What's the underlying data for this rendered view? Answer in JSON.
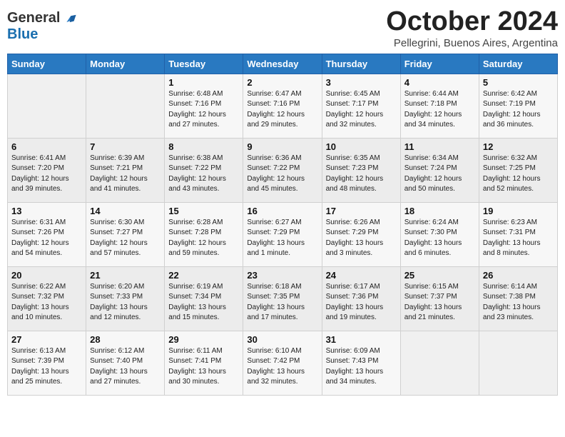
{
  "header": {
    "logo_general": "General",
    "logo_blue": "Blue",
    "month_title": "October 2024",
    "subtitle": "Pellegrini, Buenos Aires, Argentina"
  },
  "days_of_week": [
    "Sunday",
    "Monday",
    "Tuesday",
    "Wednesday",
    "Thursday",
    "Friday",
    "Saturday"
  ],
  "weeks": [
    [
      {
        "num": "",
        "sunrise": "",
        "sunset": "",
        "daylight": ""
      },
      {
        "num": "",
        "sunrise": "",
        "sunset": "",
        "daylight": ""
      },
      {
        "num": "1",
        "sunrise": "Sunrise: 6:48 AM",
        "sunset": "Sunset: 7:16 PM",
        "daylight": "Daylight: 12 hours and 27 minutes."
      },
      {
        "num": "2",
        "sunrise": "Sunrise: 6:47 AM",
        "sunset": "Sunset: 7:16 PM",
        "daylight": "Daylight: 12 hours and 29 minutes."
      },
      {
        "num": "3",
        "sunrise": "Sunrise: 6:45 AM",
        "sunset": "Sunset: 7:17 PM",
        "daylight": "Daylight: 12 hours and 32 minutes."
      },
      {
        "num": "4",
        "sunrise": "Sunrise: 6:44 AM",
        "sunset": "Sunset: 7:18 PM",
        "daylight": "Daylight: 12 hours and 34 minutes."
      },
      {
        "num": "5",
        "sunrise": "Sunrise: 6:42 AM",
        "sunset": "Sunset: 7:19 PM",
        "daylight": "Daylight: 12 hours and 36 minutes."
      }
    ],
    [
      {
        "num": "6",
        "sunrise": "Sunrise: 6:41 AM",
        "sunset": "Sunset: 7:20 PM",
        "daylight": "Daylight: 12 hours and 39 minutes."
      },
      {
        "num": "7",
        "sunrise": "Sunrise: 6:39 AM",
        "sunset": "Sunset: 7:21 PM",
        "daylight": "Daylight: 12 hours and 41 minutes."
      },
      {
        "num": "8",
        "sunrise": "Sunrise: 6:38 AM",
        "sunset": "Sunset: 7:22 PM",
        "daylight": "Daylight: 12 hours and 43 minutes."
      },
      {
        "num": "9",
        "sunrise": "Sunrise: 6:36 AM",
        "sunset": "Sunset: 7:22 PM",
        "daylight": "Daylight: 12 hours and 45 minutes."
      },
      {
        "num": "10",
        "sunrise": "Sunrise: 6:35 AM",
        "sunset": "Sunset: 7:23 PM",
        "daylight": "Daylight: 12 hours and 48 minutes."
      },
      {
        "num": "11",
        "sunrise": "Sunrise: 6:34 AM",
        "sunset": "Sunset: 7:24 PM",
        "daylight": "Daylight: 12 hours and 50 minutes."
      },
      {
        "num": "12",
        "sunrise": "Sunrise: 6:32 AM",
        "sunset": "Sunset: 7:25 PM",
        "daylight": "Daylight: 12 hours and 52 minutes."
      }
    ],
    [
      {
        "num": "13",
        "sunrise": "Sunrise: 6:31 AM",
        "sunset": "Sunset: 7:26 PM",
        "daylight": "Daylight: 12 hours and 54 minutes."
      },
      {
        "num": "14",
        "sunrise": "Sunrise: 6:30 AM",
        "sunset": "Sunset: 7:27 PM",
        "daylight": "Daylight: 12 hours and 57 minutes."
      },
      {
        "num": "15",
        "sunrise": "Sunrise: 6:28 AM",
        "sunset": "Sunset: 7:28 PM",
        "daylight": "Daylight: 12 hours and 59 minutes."
      },
      {
        "num": "16",
        "sunrise": "Sunrise: 6:27 AM",
        "sunset": "Sunset: 7:29 PM",
        "daylight": "Daylight: 13 hours and 1 minute."
      },
      {
        "num": "17",
        "sunrise": "Sunrise: 6:26 AM",
        "sunset": "Sunset: 7:29 PM",
        "daylight": "Daylight: 13 hours and 3 minutes."
      },
      {
        "num": "18",
        "sunrise": "Sunrise: 6:24 AM",
        "sunset": "Sunset: 7:30 PM",
        "daylight": "Daylight: 13 hours and 6 minutes."
      },
      {
        "num": "19",
        "sunrise": "Sunrise: 6:23 AM",
        "sunset": "Sunset: 7:31 PM",
        "daylight": "Daylight: 13 hours and 8 minutes."
      }
    ],
    [
      {
        "num": "20",
        "sunrise": "Sunrise: 6:22 AM",
        "sunset": "Sunset: 7:32 PM",
        "daylight": "Daylight: 13 hours and 10 minutes."
      },
      {
        "num": "21",
        "sunrise": "Sunrise: 6:20 AM",
        "sunset": "Sunset: 7:33 PM",
        "daylight": "Daylight: 13 hours and 12 minutes."
      },
      {
        "num": "22",
        "sunrise": "Sunrise: 6:19 AM",
        "sunset": "Sunset: 7:34 PM",
        "daylight": "Daylight: 13 hours and 15 minutes."
      },
      {
        "num": "23",
        "sunrise": "Sunrise: 6:18 AM",
        "sunset": "Sunset: 7:35 PM",
        "daylight": "Daylight: 13 hours and 17 minutes."
      },
      {
        "num": "24",
        "sunrise": "Sunrise: 6:17 AM",
        "sunset": "Sunset: 7:36 PM",
        "daylight": "Daylight: 13 hours and 19 minutes."
      },
      {
        "num": "25",
        "sunrise": "Sunrise: 6:15 AM",
        "sunset": "Sunset: 7:37 PM",
        "daylight": "Daylight: 13 hours and 21 minutes."
      },
      {
        "num": "26",
        "sunrise": "Sunrise: 6:14 AM",
        "sunset": "Sunset: 7:38 PM",
        "daylight": "Daylight: 13 hours and 23 minutes."
      }
    ],
    [
      {
        "num": "27",
        "sunrise": "Sunrise: 6:13 AM",
        "sunset": "Sunset: 7:39 PM",
        "daylight": "Daylight: 13 hours and 25 minutes."
      },
      {
        "num": "28",
        "sunrise": "Sunrise: 6:12 AM",
        "sunset": "Sunset: 7:40 PM",
        "daylight": "Daylight: 13 hours and 27 minutes."
      },
      {
        "num": "29",
        "sunrise": "Sunrise: 6:11 AM",
        "sunset": "Sunset: 7:41 PM",
        "daylight": "Daylight: 13 hours and 30 minutes."
      },
      {
        "num": "30",
        "sunrise": "Sunrise: 6:10 AM",
        "sunset": "Sunset: 7:42 PM",
        "daylight": "Daylight: 13 hours and 32 minutes."
      },
      {
        "num": "31",
        "sunrise": "Sunrise: 6:09 AM",
        "sunset": "Sunset: 7:43 PM",
        "daylight": "Daylight: 13 hours and 34 minutes."
      },
      {
        "num": "",
        "sunrise": "",
        "sunset": "",
        "daylight": ""
      },
      {
        "num": "",
        "sunrise": "",
        "sunset": "",
        "daylight": ""
      }
    ]
  ]
}
